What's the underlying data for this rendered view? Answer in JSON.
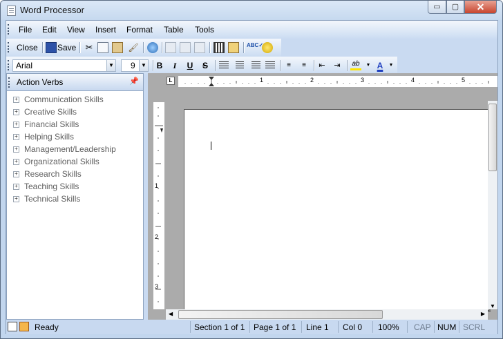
{
  "window": {
    "title": "Word Processor",
    "controls": {
      "minimize": "▭",
      "maximize": "▢",
      "close": "✕"
    }
  },
  "menu": [
    "File",
    "Edit",
    "View",
    "Insert",
    "Format",
    "Table",
    "Tools"
  ],
  "standard_toolbar": {
    "close_label": "Close",
    "save_label": "Save",
    "icons": [
      "cut-icon",
      "copy-icon",
      "paste-icon",
      "format-painter-icon",
      "hyperlink-icon",
      "undo-icon",
      "redo-icon",
      "redo-all-icon",
      "columns-icon",
      "find-icon",
      "spellcheck-icon",
      "replace-icon"
    ]
  },
  "format_toolbar": {
    "font": "Arial",
    "size": "9",
    "bold": "B",
    "italic": "I",
    "underline": "U",
    "strike": "S",
    "highlight_label": "ab",
    "font_color_label": "A"
  },
  "action_verbs": {
    "title": "Action Verbs",
    "items": [
      "Communication Skills",
      "Creative Skills",
      "Financial Skills",
      "Helping Skills",
      "Management/Leadership",
      "Organizational Skills",
      "Research Skills",
      "Teaching Skills",
      "Technical Skills"
    ]
  },
  "ruler": {
    "h_numbers": [
      "1",
      "2",
      "3",
      "4",
      "5"
    ],
    "v_numbers": [
      "1",
      "2",
      "3"
    ]
  },
  "status_bar": {
    "ready": "Ready",
    "section": "Section 1 of 1",
    "page": "Page 1 of 1",
    "line": "Line 1",
    "col": "Col 0",
    "zoom": "100%",
    "cap": "CAP",
    "num": "NUM",
    "scrl": "SCRL"
  },
  "colors": {
    "frame": "#c9daf1",
    "close_button": "#c8452e",
    "highlight": "#ffe600",
    "font_color": "#1f3fbf"
  }
}
